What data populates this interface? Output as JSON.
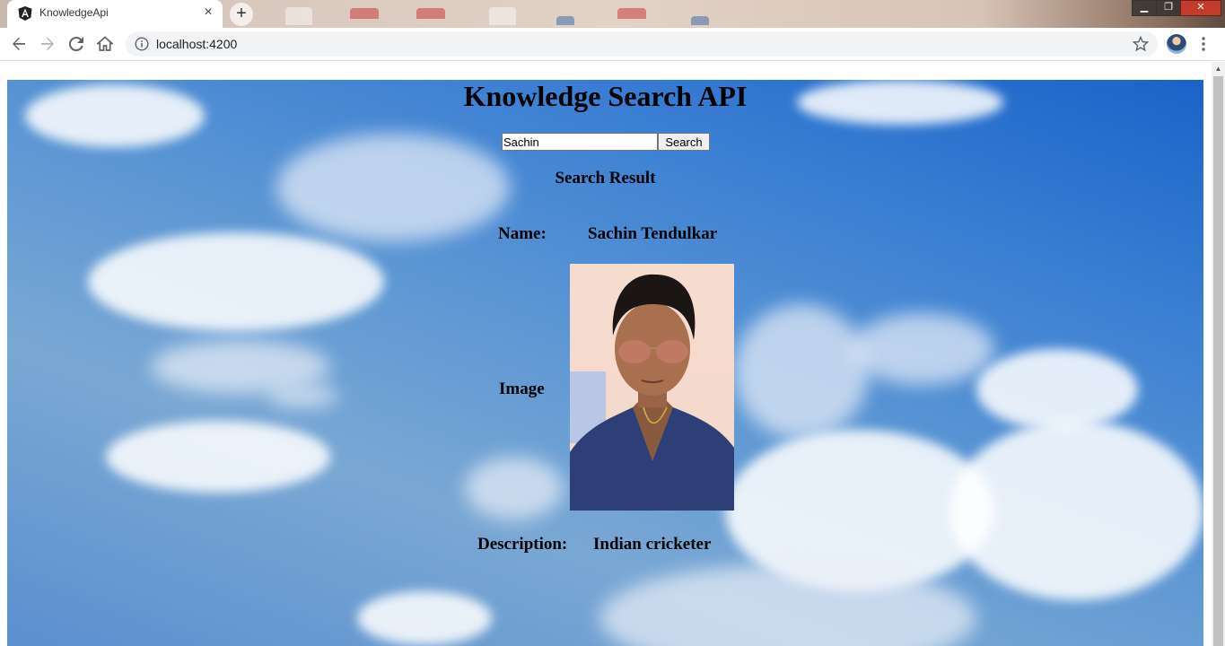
{
  "browser": {
    "tab_title": "KnowledgeApi",
    "url": "localhost:4200"
  },
  "page": {
    "title": "Knowledge Search API",
    "search": {
      "value": "Sachin",
      "button_label": "Search"
    },
    "result_heading": "Search Result",
    "result": {
      "name_label": "Name:",
      "name_value": "Sachin Tendulkar",
      "image_label": "Image",
      "description_label": "Description:",
      "description_value": "Indian cricketer"
    }
  },
  "icons": {
    "tab": "angular-icon",
    "tab_close": "close-icon",
    "new_tab": "plus-icon",
    "back": "back-arrow-icon",
    "forward": "forward-arrow-icon",
    "reload": "reload-icon",
    "home": "home-icon",
    "site_info": "info-icon",
    "bookmark": "star-icon",
    "menu": "kebab-menu-icon"
  },
  "colors": {
    "sky_top": "#1b63c9",
    "sky_mid": "#5f98d4",
    "omnibox": "#f1f3f4"
  }
}
